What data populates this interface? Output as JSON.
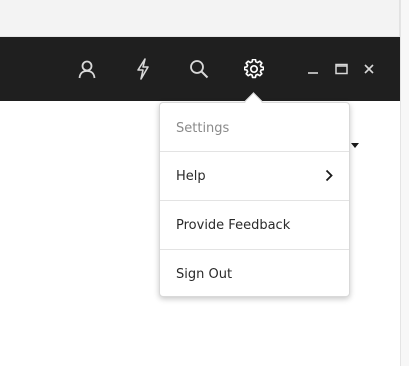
{
  "titlebar": {
    "background": "#1f1f1f",
    "icons": [
      {
        "name": "user-icon"
      },
      {
        "name": "lightning-icon"
      },
      {
        "name": "search-icon"
      },
      {
        "name": "gear-icon"
      }
    ],
    "window_controls": [
      {
        "name": "minimize-icon"
      },
      {
        "name": "maximize-icon"
      },
      {
        "name": "close-icon"
      }
    ]
  },
  "settings_menu": {
    "header": "Settings",
    "items": [
      {
        "label": "Help",
        "has_submenu": true,
        "submenu_icon": "chevron-right-icon"
      },
      {
        "label": "Provide Feedback"
      },
      {
        "label": "Sign Out"
      }
    ]
  }
}
